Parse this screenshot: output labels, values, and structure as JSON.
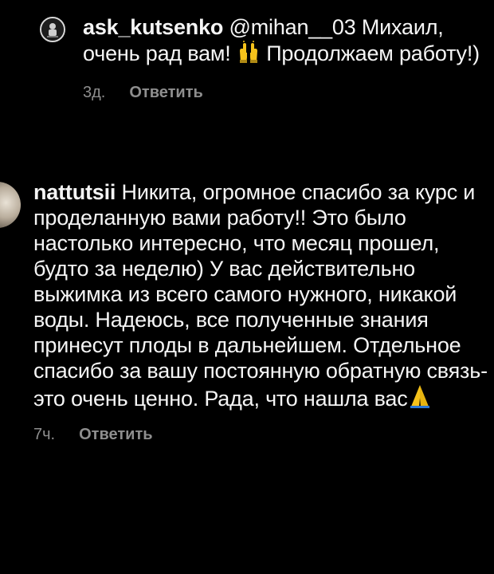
{
  "comments": [
    {
      "username": "ask_kutsenko",
      "mention": "@mihan__03",
      "text_before_emoji": "Михаил, очень рад вам!",
      "text_after_emoji": "Продолжаем работу!)",
      "emoji_icon": "raised-hands-icon",
      "time": "3д.",
      "reply_label": "Ответить"
    },
    {
      "username": "nattutsii",
      "text": "Никита, огромное спасибо за курс и проделанную вами работу!! Это было настолько интересно, что месяц прошел, будто за неделю) У вас действительно выжимка из всего самого нужного, никакой воды. Надеюсь, все полученные знания принесут плоды в дальнейшем. Отдельное спасибо  за вашу постоянную обратную связь-это очень ценно. Рада, что нашла вас",
      "emoji_icon": "folded-hands-icon",
      "time": "7ч.",
      "reply_label": "Ответить"
    }
  ]
}
